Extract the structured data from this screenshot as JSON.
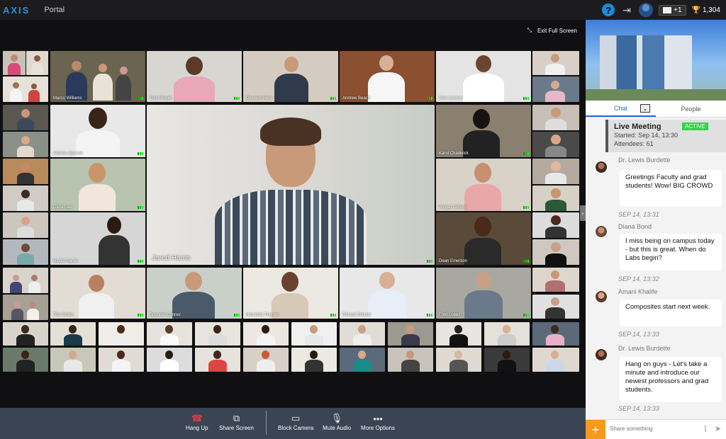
{
  "topbar": {
    "logo": "AXIS",
    "portal": "Portal",
    "messages_count": "+1",
    "points": "1,304"
  },
  "stage": {
    "exit_full_screen": "Exit Full Screen",
    "featured_name": "Jared Harris",
    "names": {
      "marco": "Marco Williams",
      "trent": "Trent Boyer",
      "dawson": "Dawson Hess",
      "andrew": "Andrew Beach",
      "alec": "Alec Lennon",
      "aleisha": "Aleisha Spence",
      "karol": "Karol Chadwick",
      "dana": "Dana Lee",
      "abigail": "Abigail Clifford",
      "nicole": "Nicole Hanks",
      "dean": "Dean Emerson",
      "tom": "Tom Smith",
      "spencer": "Spencer Conner",
      "henrietta": "Henrietta Traynor",
      "roland": "Roland Schultz",
      "fred": "Fred Lopez"
    }
  },
  "toolbar": {
    "hang_up": "Hang Up",
    "share_screen": "Share Screen",
    "block_camera": "Block Camera",
    "mute_audio": "Mute Audio",
    "more_options": "More Options"
  },
  "panel": {
    "tabs": {
      "chat": "Chat",
      "people": "People"
    },
    "live": {
      "title": "Live Meeting",
      "status": "ACTIVE",
      "started": "Started: Sep 14, 13:30",
      "attendees": "Attendees: 61"
    },
    "messages": [
      {
        "name": "Dr. Lewis Burdette",
        "text": "Greetings Faculty and grad students! Wow! BIG CROWD",
        "time": "SEP 14, 13:31"
      },
      {
        "name": "Diana Bond",
        "text": "I miss being on campus today - but this is great. When do Labs begin?",
        "time": "SEP 14, 13:32"
      },
      {
        "name": "Amani Khalife",
        "text": "Composites start next week.",
        "time": "SEP 14, 13:33"
      },
      {
        "name": "Dr. Lewis Burdette",
        "text": "Hang on guys - Let's take a minute and introduce our newest professors and grad students.",
        "time": "SEP 14, 13:33"
      }
    ],
    "composer_placeholder": "Share something"
  }
}
